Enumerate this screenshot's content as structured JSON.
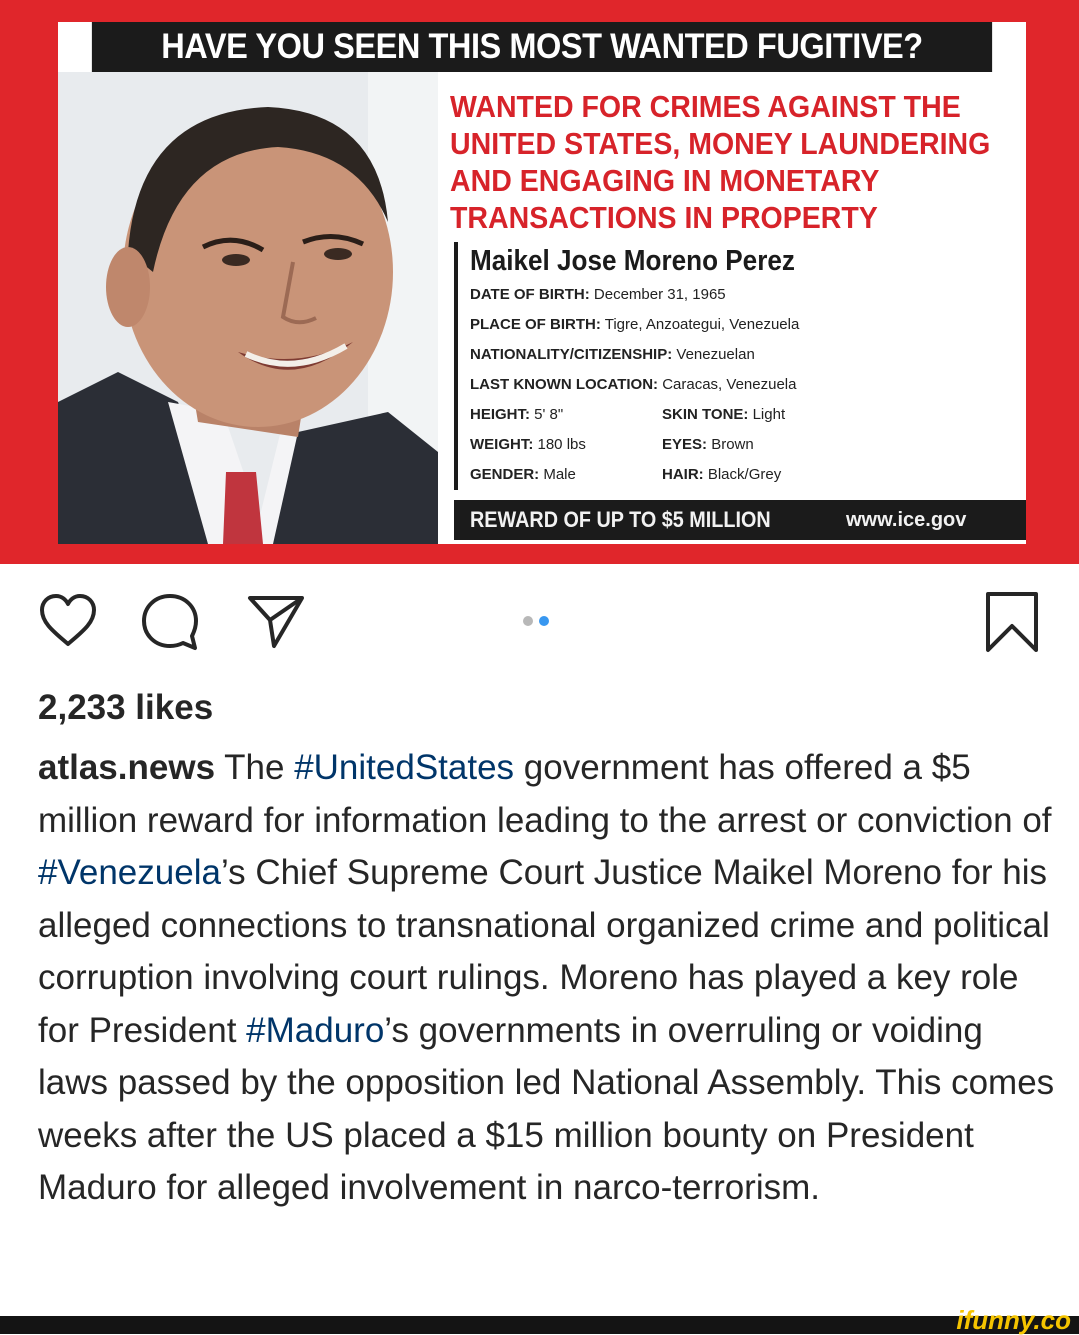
{
  "poster": {
    "headline": "HAVE YOU SEEN THIS MOST WANTED FUGITIVE?",
    "crimes": [
      "WANTED FOR CRIMES AGAINST THE",
      "UNITED STATES, MONEY LAUNDERING",
      "AND ENGAGING IN MONETARY",
      "TRANSACTIONS IN PROPERTY"
    ],
    "name": "Maikel Jose Moreno Perez",
    "dob_label": "DATE OF BIRTH:",
    "dob_value": "December 31, 1965",
    "pob_label": "PLACE OF BIRTH:",
    "pob_value": "Tigre, Anzoategui, Venezuela",
    "nat_label": "NATIONALITY/CITIZENSHIP:",
    "nat_value": "Venezuelan",
    "loc_label": "LAST KNOWN LOCATION:",
    "loc_value": "Caracas, Venezuela",
    "height_label": "HEIGHT:",
    "height_value": "5' 8\"",
    "skin_label": "SKIN TONE:",
    "skin_value": "Light",
    "weight_label": "WEIGHT:",
    "weight_value": "180 lbs",
    "eyes_label": "EYES:",
    "eyes_value": "Brown",
    "gender_label": "GENDER:",
    "gender_value": "Male",
    "hair_label": "HAIR:",
    "hair_value": "Black/Grey",
    "reward": "REWARD OF UP TO $5 MILLION",
    "site": "www.ice.gov"
  },
  "actions": {
    "like_icon": "heart-icon",
    "comment_icon": "comment-icon",
    "share_icon": "paper-plane-icon",
    "save_icon": "bookmark-icon",
    "carousel_index": 2,
    "carousel_count": 2
  },
  "post": {
    "likes": "2,233 likes",
    "username": "atlas.news",
    "caption": [
      {
        "t": "text",
        "v": " The "
      },
      {
        "t": "tag",
        "v": "#UnitedStates"
      },
      {
        "t": "text",
        "v": " government has offered a $5 million reward for information leading to the arrest or conviction of "
      },
      {
        "t": "tag",
        "v": "#Venezuela"
      },
      {
        "t": "text",
        "v": "’s Chief Supreme Court Justice Maikel Moreno for his alleged connections to transnational organized crime and political corruption involving court rulings. Moreno has played a key role for President "
      },
      {
        "t": "tag",
        "v": "#Maduro"
      },
      {
        "t": "text",
        "v": "’s governments in overruling or voiding laws passed by the opposition led National Assembly. This comes weeks after the US placed a $15 million bounty on President Maduro for alleged involvement in narco-terrorism."
      }
    ]
  },
  "watermark": "ifunny.co",
  "colors": {
    "poster_red": "#e0262b",
    "hashtag": "#003569",
    "carousel_active": "#3897f0"
  }
}
